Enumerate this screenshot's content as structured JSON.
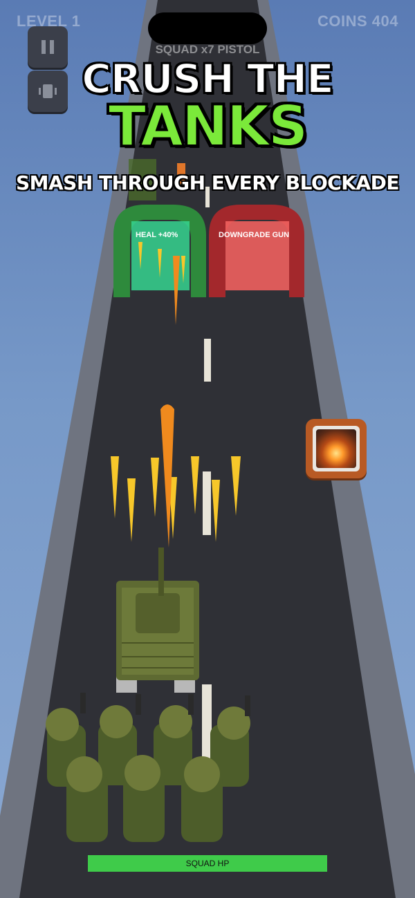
{
  "hud": {
    "level": "LEVEL 1",
    "coins": "COINS 404",
    "squad_info": "SQUAD x7   PISTOL"
  },
  "headline": {
    "line1": "CRUSH THE",
    "line2": "TANKS",
    "tagline": "SMASH THROUGH EVERY BLOCKADE"
  },
  "gates": [
    {
      "label": "HEAL +40%",
      "color": "#2e8a3c"
    },
    {
      "label": "DOWNGRADE GUN",
      "color": "#a3282c"
    }
  ],
  "squad_hp": {
    "label": "SQUAD HP",
    "fill": 1.0,
    "color": "#3fcb4a"
  },
  "icons": [
    "pause-icon",
    "vibrate-icon",
    "explosion-powerup-icon"
  ],
  "colors": {
    "road": "#2f3036",
    "headline_green": "#7be93a",
    "tank": "#5e6a32"
  }
}
